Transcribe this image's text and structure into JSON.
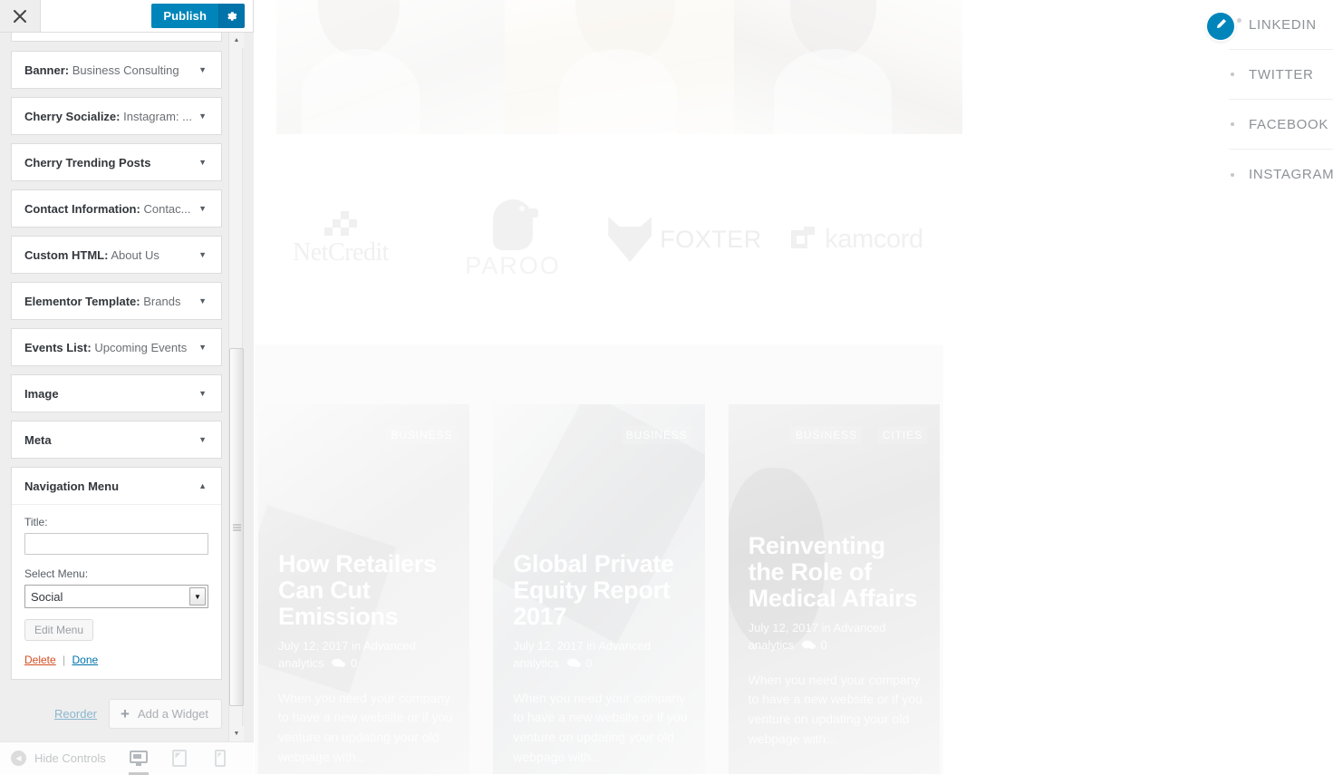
{
  "customizer": {
    "close_label": "Close customizer",
    "publish_label": "Publish",
    "gear_label": "Publish settings",
    "widgets": [
      {
        "name": "Banner",
        "value": "Business Consulting",
        "expanded": false
      },
      {
        "name": "Cherry Socialize",
        "value": "Instagram: ...",
        "expanded": false
      },
      {
        "name": "Cherry Trending Posts",
        "value": "",
        "expanded": false
      },
      {
        "name": "Contact Information",
        "value": "Contac...",
        "expanded": false
      },
      {
        "name": "Custom HTML",
        "value": "About Us",
        "expanded": false
      },
      {
        "name": "Elementor Template",
        "value": "Brands",
        "expanded": false
      },
      {
        "name": "Events List",
        "value": "Upcoming Events",
        "expanded": false
      },
      {
        "name": "Image",
        "value": "",
        "expanded": false
      },
      {
        "name": "Meta",
        "value": "",
        "expanded": false
      },
      {
        "name": "Navigation Menu",
        "value": "",
        "expanded": true
      }
    ],
    "nav_menu_form": {
      "title_label": "Title:",
      "title_value": "",
      "title_placeholder": "",
      "select_menu_label": "Select Menu:",
      "selected_menu": "Social",
      "menu_options": [
        "Social"
      ],
      "edit_menu_label": "Edit Menu",
      "delete_label": "Delete",
      "separator": "|",
      "done_label": "Done"
    },
    "actions": {
      "reorder_label": "Reorder",
      "add_widget_label": "Add a Widget",
      "plus_icon": "plus-icon"
    },
    "footer": {
      "hide_controls_label": "Hide Controls",
      "devices": [
        {
          "name": "desktop",
          "label": "Desktop",
          "active": true
        },
        {
          "name": "tablet",
          "label": "Tablet",
          "active": false
        },
        {
          "name": "mobile",
          "label": "Mobile",
          "active": false
        }
      ]
    },
    "accent_color": "#0085ba",
    "gear_color": "#0073aa",
    "delete_color": "#d54e21",
    "link_color": "#0073aa"
  },
  "preview": {
    "brands": [
      {
        "name": "NetCredit"
      },
      {
        "name": "PAROO"
      },
      {
        "name": "FOXTER"
      },
      {
        "name": "kamcord"
      }
    ],
    "posts": [
      {
        "categories": [
          "BUSINESS"
        ],
        "title": "How Retailers Can Cut Emissions",
        "date": "July 12, 2017",
        "in_word": "in",
        "category_link": "Advanced analytics",
        "comment_icon": "comment-icon",
        "comment_count": "0",
        "excerpt": "When you need your company to have a new website or if you venture on updating your old webpage with..."
      },
      {
        "categories": [
          "BUSINESS"
        ],
        "title": "Global Private Equity Report 2017",
        "date": "July 12, 2017",
        "in_word": "in",
        "category_link": "Advanced analytics",
        "comment_icon": "comment-icon",
        "comment_count": "0",
        "excerpt": "When you need your company to have a new website or if you venture on updating your old webpage with..."
      },
      {
        "categories": [
          "BUSINESS",
          "CITIES"
        ],
        "title": "Reinventing the Role of Medical Affairs",
        "date": "July 12, 2017",
        "in_word": "in",
        "category_link": "Advanced analytics",
        "comment_icon": "comment-icon",
        "comment_count": "0",
        "excerpt": "When you need your company to have a new website or if you venture on updating your old webpage with..."
      }
    ],
    "social_menu": [
      {
        "label": "LINKEDIN"
      },
      {
        "label": "TWITTER"
      },
      {
        "label": "FACEBOOK"
      },
      {
        "label": "INSTAGRAM"
      }
    ],
    "edit_shortcut_icon": "pencil-icon"
  }
}
